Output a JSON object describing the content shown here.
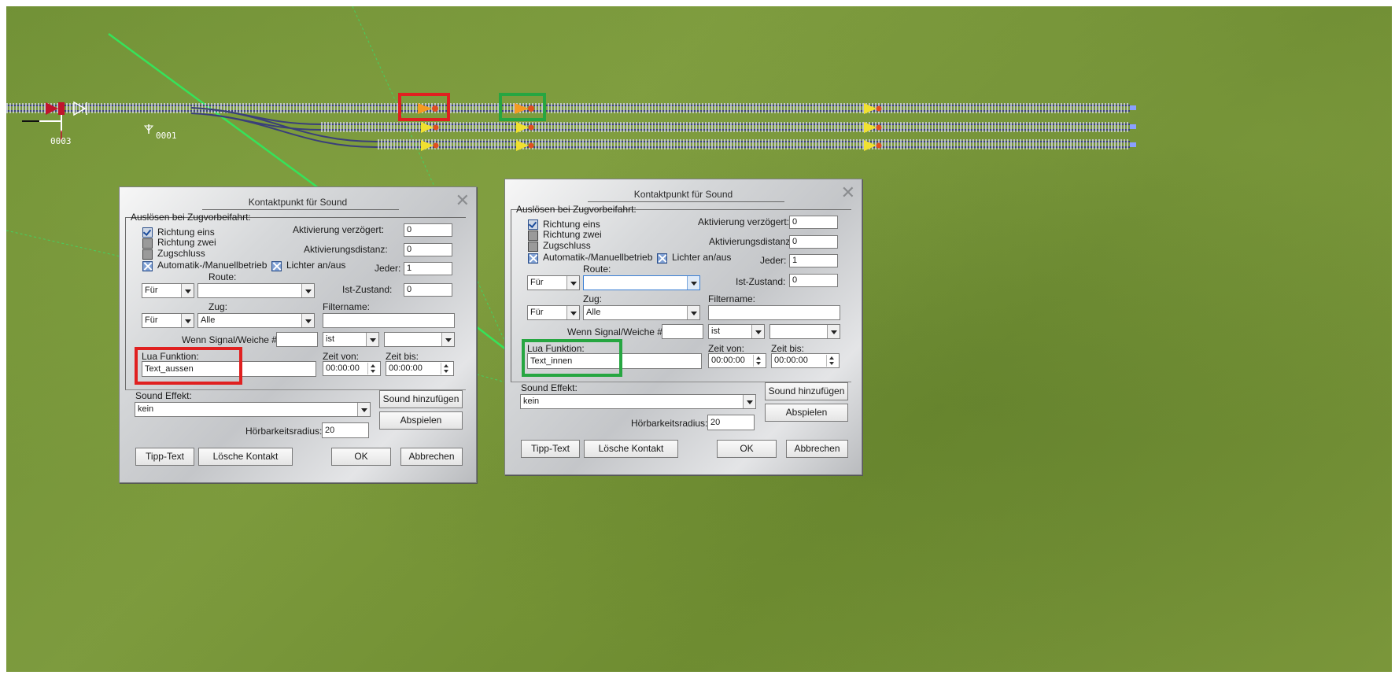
{
  "labels": {
    "contact_left": "0003",
    "contact_mid": "0001"
  },
  "colors": {
    "highlight_red": "#e02020",
    "highlight_green": "#26a641",
    "track_line": "#35e35a"
  },
  "dialogs": [
    {
      "title": "Kontaktpunkt für Sound",
      "group_label": "Auslösen bei Zugvorbeifahrt:",
      "cb_richtung_eins": "Richtung eins",
      "cb_richtung_zwei": "Richtung zwei",
      "cb_zugschluss": "Zugschluss",
      "cb_automatik": "Automatik-/Manuellbetrieb",
      "cb_lichter": "Lichter an/aus",
      "lbl_aktiv_verz": "Aktivierung verzögert:",
      "val_aktiv_verz": "0",
      "lbl_aktiv_dist": "Aktivierungsdistanz:",
      "val_aktiv_dist": "0",
      "lbl_jeder": "Jeder:",
      "val_jeder": "1",
      "lbl_route": "Route:",
      "sel_fuer_route": "Für",
      "val_route": "",
      "lbl_ist_zustand": "Ist-Zustand:",
      "val_ist_zustand": "0",
      "lbl_zug": "Zug:",
      "sel_fuer_zug": "Für",
      "val_zug": "Alle",
      "lbl_filtername": "Filtername:",
      "val_filtername": "",
      "lbl_wenn": "Wenn Signal/Weiche #",
      "val_wenn": "",
      "sel_ist": "ist",
      "sel_state": "",
      "lbl_lua": "Lua Funktion:",
      "val_lua": "Text_aussen",
      "lbl_zeit_von": "Zeit von:",
      "val_zeit_von": "00:00:00",
      "lbl_zeit_bis": "Zeit bis:",
      "val_zeit_bis": "00:00:00",
      "lbl_sound_effekt": "Sound Effekt:",
      "val_sound_effekt": "kein",
      "btn_sound_add": "Sound hinzufügen",
      "btn_play": "Abspielen",
      "lbl_radius": "Hörbarkeitsradius:",
      "val_radius": "20",
      "btn_tipp": "Tipp-Text",
      "btn_loesche": "Lösche Kontakt",
      "btn_ok": "OK",
      "btn_abbrechen": "Abbrechen"
    },
    {
      "title": "Kontaktpunkt für Sound",
      "group_label": "Auslösen bei Zugvorbeifahrt:",
      "cb_richtung_eins": "Richtung eins",
      "cb_richtung_zwei": "Richtung zwei",
      "cb_zugschluss": "Zugschluss",
      "cb_automatik": "Automatik-/Manuellbetrieb",
      "cb_lichter": "Lichter an/aus",
      "lbl_aktiv_verz": "Aktivierung verzögert:",
      "val_aktiv_verz": "0",
      "lbl_aktiv_dist": "Aktivierungsdistanz:",
      "val_aktiv_dist": "0",
      "lbl_jeder": "Jeder:",
      "val_jeder": "1",
      "lbl_route": "Route:",
      "sel_fuer_route": "Für",
      "val_route": "",
      "lbl_ist_zustand": "Ist-Zustand:",
      "val_ist_zustand": "0",
      "lbl_zug": "Zug:",
      "sel_fuer_zug": "Für",
      "val_zug": "Alle",
      "lbl_filtername": "Filtername:",
      "val_filtername": "",
      "lbl_wenn": "Wenn Signal/Weiche #",
      "val_wenn": "",
      "sel_ist": "ist",
      "sel_state": "",
      "lbl_lua": "Lua Funktion:",
      "val_lua": "Text_innen",
      "lbl_zeit_von": "Zeit von:",
      "val_zeit_von": "00:00:00",
      "lbl_zeit_bis": "Zeit bis:",
      "val_zeit_bis": "00:00:00",
      "lbl_sound_effekt": "Sound Effekt:",
      "val_sound_effekt": "kein",
      "btn_sound_add": "Sound hinzufügen",
      "btn_play": "Abspielen",
      "lbl_radius": "Hörbarkeitsradius:",
      "val_radius": "20",
      "btn_tipp": "Tipp-Text",
      "btn_loesche": "Lösche Kontakt",
      "btn_ok": "OK",
      "btn_abbrechen": "Abbrechen"
    }
  ]
}
